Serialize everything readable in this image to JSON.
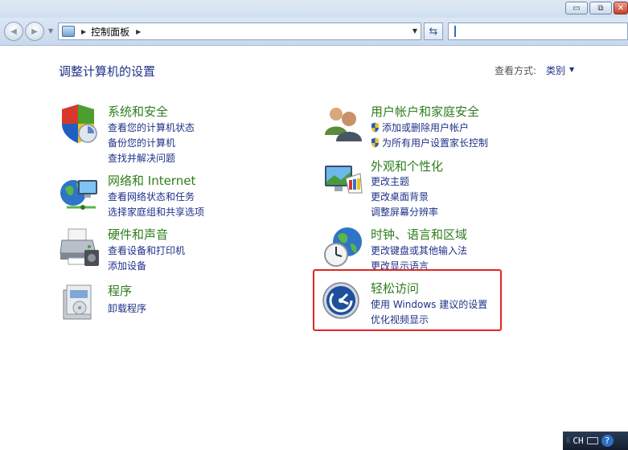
{
  "window": {
    "minimize_glyph": "▭",
    "restore_glyph": "⧉",
    "close_glyph": "✕"
  },
  "toolbar": {
    "back_glyph": "◀",
    "forward_glyph": "▶",
    "breadcrumb": "控制面板",
    "search_placeholder": ""
  },
  "page": {
    "heading": "调整计算机的设置",
    "view_by_label": "查看方式:",
    "view_by_value": "类别"
  },
  "categories": {
    "system_security": {
      "title": "系统和安全",
      "links": [
        "查看您的计算机状态",
        "备份您的计算机",
        "查找并解决问题"
      ]
    },
    "network": {
      "title": "网络和 Internet",
      "links": [
        "查看网络状态和任务",
        "选择家庭组和共享选项"
      ]
    },
    "hardware": {
      "title": "硬件和声音",
      "links": [
        "查看设备和打印机",
        "添加设备"
      ]
    },
    "programs": {
      "title": "程序",
      "links": [
        "卸载程序"
      ]
    },
    "user_accounts": {
      "title": "用户帐户和家庭安全",
      "links": [
        "添加或删除用户帐户",
        "为所有用户设置家长控制"
      ]
    },
    "appearance": {
      "title": "外观和个性化",
      "links": [
        "更改主题",
        "更改桌面背景",
        "调整屏幕分辨率"
      ]
    },
    "clock_region": {
      "title": "时钟、语言和区域",
      "links": [
        "更改键盘或其他输入法",
        "更改显示语言"
      ]
    },
    "ease_of_access": {
      "title": "轻松访问",
      "links": [
        "使用 Windows 建议的设置",
        "优化视频显示"
      ]
    }
  },
  "taskbar": {
    "language": "CH",
    "help_glyph": "?"
  },
  "colors": {
    "category_title": "#2e7d1c",
    "link": "#1e3287",
    "highlight_border": "#e02424"
  }
}
